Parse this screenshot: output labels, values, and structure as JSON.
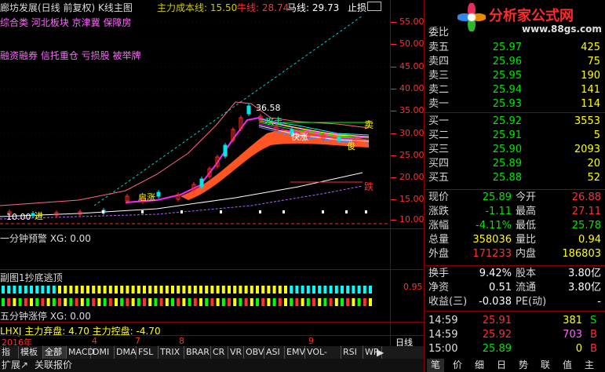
{
  "chart_header": {
    "title": "廊坊发展(日线 前复权) K线主图",
    "cost_label": "主力成本线: 15.50",
    "bull_label": "牛线: 28.74",
    "horse_label": "马线: 29.73",
    "stop_label": "止损"
  },
  "tags_row1": "综合类 河北板块 京津冀 保障房",
  "tags_row2": "融资融券 信托重仓 亏损股 被举牌",
  "price_axis": [
    "55.00",
    "50.00",
    "45.00",
    "40.00",
    "35.00",
    "30.00",
    "25.00",
    "20.00",
    "15.00",
    "10.00"
  ],
  "chart_annotations": {
    "high": "36.58",
    "low": "10.00",
    "start": "启涨",
    "sell": "卖",
    "sell2": "卖",
    "stop": "跌",
    "attack": "攻击",
    "rise": "快涨",
    "jump": "俊",
    "in": "进",
    "buy": "卖出"
  },
  "panel1_label": "一分钟预警 XG: 0.00",
  "panel2_label": "副图1抄底逃顶",
  "panel2_axis": "0.95",
  "panel3_label": "五分钟涨停 XG: 0.00",
  "panel4_label": "LHXJ 主力弃盘: 4.70 主力控盘: -4.70",
  "time_axis": {
    "year": "2016年",
    "m4": "4",
    "m7": "7",
    "m8": "8",
    "m9": "9",
    "period": "日线"
  },
  "tabs": [
    "指标",
    "模板",
    "全部",
    "MACD",
    "DMI",
    "DMA",
    "FSL",
    "TRIX",
    "BRAR",
    "CR",
    "VR",
    "OBV",
    "ASI",
    "EMV",
    "VOL-TDX",
    "RSI",
    "WR"
  ],
  "bottom_tabs": [
    "扩展↗",
    "关联报价"
  ],
  "logo": {
    "name": "分析家公式网",
    "url": "www.88gs.com"
  },
  "order_book": {
    "header": "委比",
    "sells": [
      {
        "label": "卖五",
        "price": "25.97",
        "vol": "425"
      },
      {
        "label": "卖四",
        "price": "25.96",
        "vol": "75"
      },
      {
        "label": "卖三",
        "price": "25.95",
        "vol": "190"
      },
      {
        "label": "卖二",
        "price": "25.94",
        "vol": "141"
      },
      {
        "label": "卖一",
        "price": "25.93",
        "vol": "114"
      }
    ],
    "buys": [
      {
        "label": "买一",
        "price": "25.92",
        "vol": "3553"
      },
      {
        "label": "买二",
        "price": "25.91",
        "vol": "5"
      },
      {
        "label": "买三",
        "price": "25.90",
        "vol": "2093"
      },
      {
        "label": "买四",
        "price": "25.89",
        "vol": "20"
      },
      {
        "label": "买五",
        "price": "25.88",
        "vol": "52"
      }
    ]
  },
  "quote": {
    "now_l": "现价",
    "now": "25.89",
    "open_l": "今开",
    "open": "26.88",
    "chg_l": "涨跌",
    "chg": "-1.11",
    "high_l": "最高",
    "high": "27.11",
    "pct_l": "涨幅",
    "pct": "-4.11%",
    "low_l": "最低",
    "low": "25.78",
    "vol_l": "总量",
    "vol": "358036",
    "ratio_l": "量比",
    "ratio": "0.94",
    "out_l": "外盘",
    "out": "171233",
    "in_l": "内盘",
    "in": "186803",
    "turn_l": "换手",
    "turn": "9.42%",
    "cap_l": "股本",
    "cap": "3.80亿",
    "na_l": "净资",
    "na": "0.51",
    "flow_l": "流通",
    "flow": "3.80亿",
    "eps_l": "收益(三)",
    "eps": "-0.038",
    "pe_l": "PE(动)",
    "pe": "-"
  },
  "ticks": [
    {
      "t": "14:59",
      "p": "25.91",
      "v": "381",
      "f": "S"
    },
    {
      "t": "14:59",
      "p": "25.92",
      "v": "703",
      "f": "B"
    },
    {
      "t": "15:00",
      "p": "25.89",
      "v": "0",
      "f": "B"
    }
  ],
  "right_tabs": [
    "笔",
    "价",
    "细",
    "日",
    "势",
    "联",
    "值",
    "主"
  ],
  "colors": {
    "up": "#ff3030",
    "down": "#00e600",
    "yellow": "#ffff00",
    "grid": "#8b0000"
  }
}
